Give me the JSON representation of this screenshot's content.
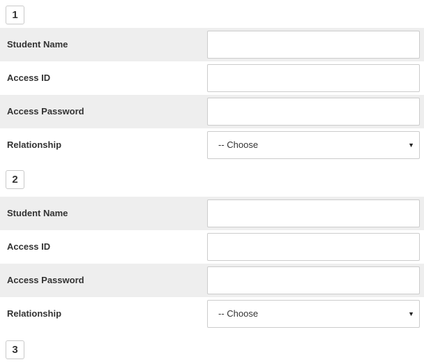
{
  "groups": [
    {
      "number": "1",
      "fields": {
        "student_name_label": "Student Name",
        "access_id_label": "Access ID",
        "access_password_label": "Access Password",
        "relationship_label": "Relationship",
        "student_name_value": "",
        "access_id_value": "",
        "access_password_value": "",
        "relationship_selected": "-- Choose"
      }
    },
    {
      "number": "2",
      "fields": {
        "student_name_label": "Student Name",
        "access_id_label": "Access ID",
        "access_password_label": "Access Password",
        "relationship_label": "Relationship",
        "student_name_value": "",
        "access_id_value": "",
        "access_password_value": "",
        "relationship_selected": "-- Choose"
      }
    },
    {
      "number": "3"
    }
  ],
  "icons": {
    "dropdown": "caret-down-icon"
  },
  "colors": {
    "shaded_row": "#eeeeee",
    "border": "#cccccc",
    "text": "#333333"
  }
}
